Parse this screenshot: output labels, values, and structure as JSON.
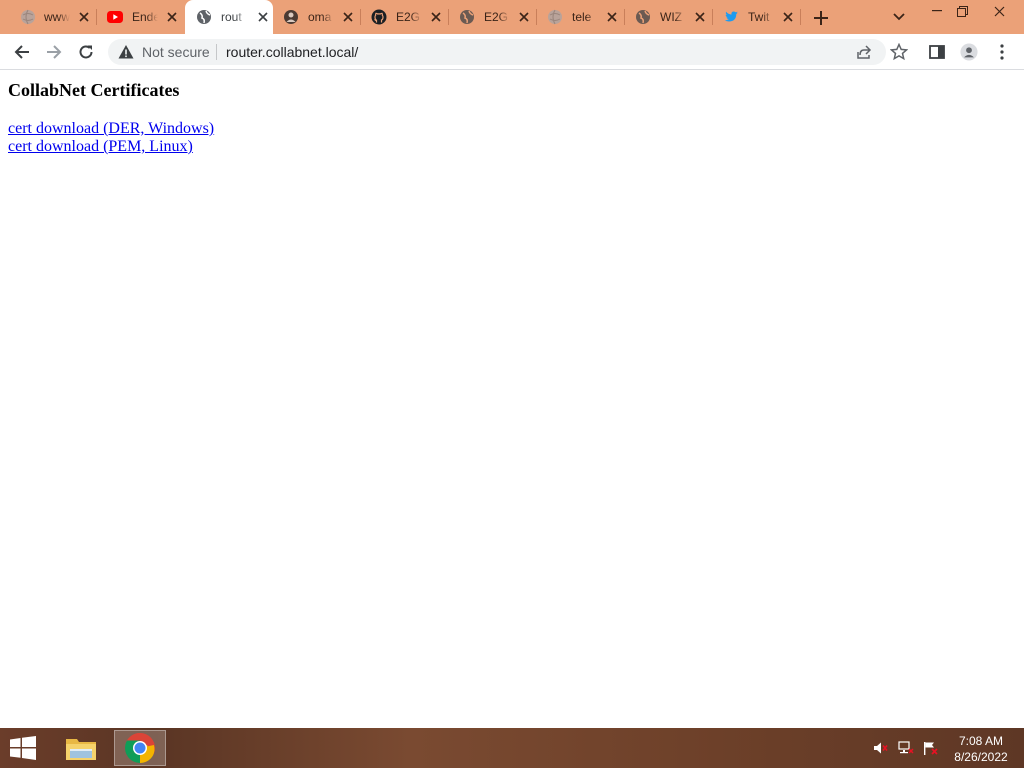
{
  "browser": {
    "tabs": [
      {
        "title": "www",
        "favicon": "generic-globe-icon",
        "active": false
      },
      {
        "title": "Ende",
        "favicon": "youtube-icon",
        "active": false
      },
      {
        "title": "rout",
        "favicon": "globe-icon",
        "active": true
      },
      {
        "title": "oma",
        "favicon": "avatar-globe-icon",
        "active": false
      },
      {
        "title": "E2G",
        "favicon": "github-icon",
        "active": false
      },
      {
        "title": "E2G",
        "favicon": "globe-icon",
        "active": false
      },
      {
        "title": "tele",
        "favicon": "generic-globe-icon",
        "active": false
      },
      {
        "title": "WIZ",
        "favicon": "globe-icon",
        "active": false
      },
      {
        "title": "Twit",
        "favicon": "twitter-icon",
        "active": false
      }
    ],
    "omnibox": {
      "security_label": "Not secure",
      "url": "router.collabnet.local/"
    },
    "colors": {
      "tab_strip": "#eba178",
      "link": "#0000ee",
      "youtube": "#ff0000",
      "twitter": "#1d9bf0"
    }
  },
  "page": {
    "heading": "CollabNet Certificates",
    "links": [
      "cert download (DER, Windows)",
      "cert download (PEM, Linux)"
    ]
  },
  "taskbar": {
    "apps": [
      "file-explorer-icon",
      "chrome-icon"
    ],
    "tray": [
      "volume-muted-icon",
      "network-icon",
      "action-center-flag-icon"
    ],
    "time": "7:08 AM",
    "date": "8/26/2022"
  }
}
